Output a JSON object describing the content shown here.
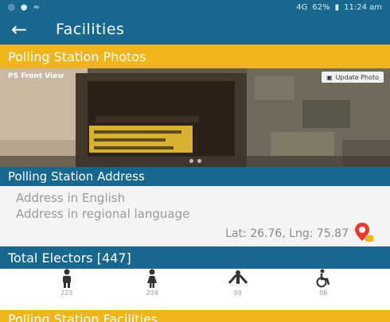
{
  "status_bar": {
    "left_icons": [
      "notification-icon",
      "alert-icon",
      "signal-icon"
    ],
    "network": "4G",
    "battery": "62%",
    "time": "11:24 am"
  },
  "app_bar": {
    "title": "Facilities"
  },
  "photos_section": {
    "title": "Polling Station Photos",
    "caption": "PS Front View",
    "update_button": "Update Photo"
  },
  "address_section": {
    "title": "Polling Station Address",
    "address_english": "Address in English",
    "address_regional": "Address in regional language",
    "latlng": "Lat: 26.76, Lng: 75.87"
  },
  "electors_section": {
    "title": "Total Electors [447]",
    "items": [
      {
        "icon": "male-icon",
        "count": "223"
      },
      {
        "icon": "female-icon",
        "count": "224"
      },
      {
        "icon": "third-gender-icon",
        "count": "00"
      },
      {
        "icon": "pwd-icon",
        "count": "06"
      }
    ]
  },
  "facilities_section": {
    "title": "Polling Station Facilities"
  },
  "colors": {
    "primary": "#17678f",
    "accent": "#f0b51a"
  }
}
